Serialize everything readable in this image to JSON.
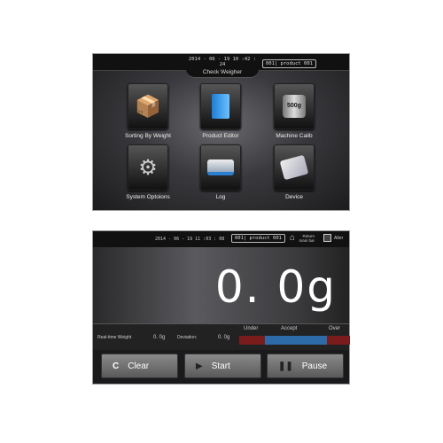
{
  "menu_screen": {
    "datetime": "2014 - 06 - 19  10 :42 : 24",
    "title": "Check Weigher",
    "product": "001| product 001",
    "items": [
      {
        "label": "Sorting By Weight",
        "icon": "box-conveyor-icon"
      },
      {
        "label": "Product Editor",
        "icon": "document-icon"
      },
      {
        "label": "Machine Calib",
        "icon": "weight-500g-icon",
        "icon_text": "500g"
      },
      {
        "label": "System Optoions",
        "icon": "gear-icon"
      },
      {
        "label": "Log",
        "icon": "printer-icon"
      },
      {
        "label": "Device",
        "icon": "device-icon"
      }
    ]
  },
  "weigh_screen": {
    "datetime": "2014 - 06 - 19  11 :03 : 08",
    "product": "001| product 001",
    "return_label": "Return main bar",
    "alter_label": "Alter",
    "weight": "0. 0g",
    "realtime_label": "Real-time Weight",
    "realtime_value": "0. 0g",
    "deviation_label": "Deviation:",
    "deviation_value": "0. 0g",
    "under": "Under",
    "accept": "Accept",
    "over": "Over",
    "colors": {
      "under": "#7a1c1c",
      "accept": "#2c6aa8",
      "over": "#7a1c1c"
    },
    "buttons": {
      "clear": "Clear",
      "start": "Start",
      "pause": "Pause"
    }
  }
}
